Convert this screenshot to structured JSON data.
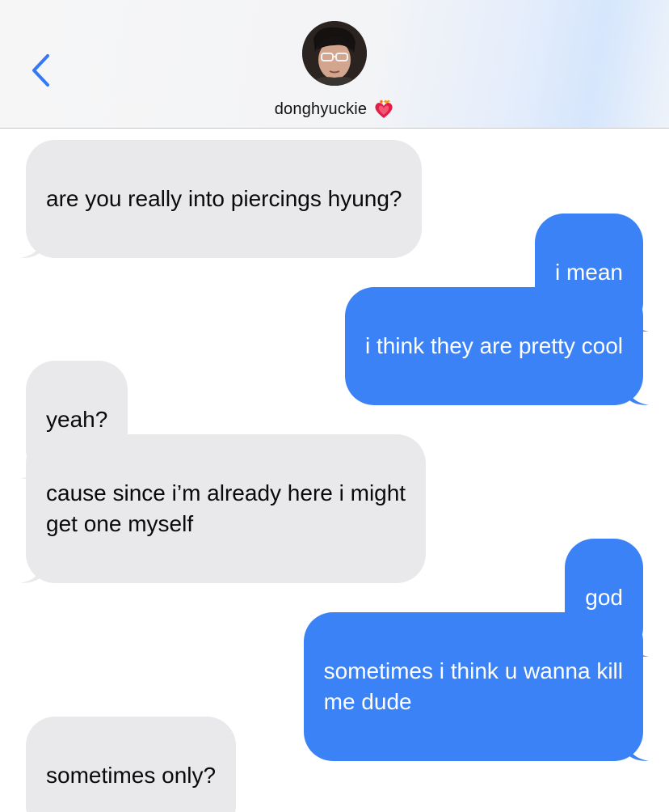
{
  "header": {
    "contact_name": "donghyuckie",
    "icons": {
      "back": "chevron-left-icon",
      "badge": "heart-on-fire-emoji",
      "avatar": "contact-avatar"
    },
    "accent_color": "#3b82f6"
  },
  "messages": [
    {
      "from": "them",
      "text": "are you really into piercings hyung?"
    },
    {
      "from": "me",
      "text": "i mean"
    },
    {
      "from": "me",
      "text": "i think they are pretty cool"
    },
    {
      "from": "them",
      "text": "yeah?"
    },
    {
      "from": "them",
      "text": "cause since i’m already here i might\nget one myself"
    },
    {
      "from": "me",
      "text": "god"
    },
    {
      "from": "me",
      "text": "sometimes i think u wanna kill\nme dude"
    },
    {
      "from": "them",
      "text": "sometimes only?"
    }
  ],
  "colors": {
    "sent_bubble": "#3b82f6",
    "received_bubble": "#e9e9eb"
  }
}
